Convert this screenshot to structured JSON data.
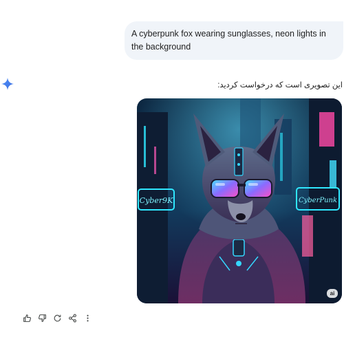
{
  "user_prompt": {
    "text": "A cyberpunk fox wearing sunglasses, neon lights in the background"
  },
  "response": {
    "text": "این تصویری است که درخواست کردید:",
    "image_badge": "ai"
  },
  "image_sign_texts": [
    "Cyber9K",
    "CyberPunk"
  ],
  "actions": [
    {
      "icon": "thumbs-up-icon"
    },
    {
      "icon": "thumbs-down-icon"
    },
    {
      "icon": "refresh-icon"
    },
    {
      "icon": "share-icon"
    },
    {
      "icon": "more-vertical-icon"
    }
  ],
  "colors": {
    "bubble": "#f0f4f9",
    "sparkle": "#4285f4",
    "neon_cyan": "#2fe8ff",
    "neon_pink": "#ff3fb0"
  }
}
